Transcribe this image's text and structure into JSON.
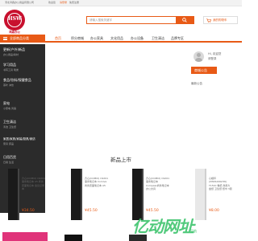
{
  "topbar": {
    "company": "河北鸿森办公用品有限公司",
    "welcome": "欢迎您",
    "signin": "请登录",
    "register": "免费注册"
  },
  "logo": {
    "mark": "HSW",
    "name": "鸿森办公"
  },
  "search": {
    "placeholder": "请输入搜索关键字"
  },
  "cart": {
    "label": "我的购物车"
  },
  "nav": {
    "all_categories": "全部商品分类",
    "items": [
      "首页",
      "积分商城",
      "办公家具",
      "文化用品",
      "办公设备",
      "卫生清洁",
      "品牌专区"
    ]
  },
  "sidebar": {
    "categories": [
      {
        "title": "更新(户外)新品",
        "sub": "办公用品/耗材"
      },
      {
        "title": "学习用品",
        "sub": "书写工具 笔类"
      },
      {
        "title": "食品/饮料/保健食品",
        "sub": "茶叶 冲饮"
      },
      {
        "title": "家电",
        "sub": "小家电 风扇"
      },
      {
        "title": "卫生清洁",
        "sub": "清洁 卫生纸"
      },
      {
        "title": "家居/家具/家装/厨具/家纺",
        "sub": "家具 床品"
      },
      {
        "title": "日用百货",
        "sub": "日用 生活"
      }
    ]
  },
  "user_panel": {
    "greeting": "Hi, 欢迎您",
    "signin": "请登录",
    "notice_button": "商城公告",
    "announcement": "最新公告"
  },
  "section": {
    "title": "新品上市"
  },
  "products": [
    {
      "desc": "齐心(COMIX) C9201 事务笔记本 A5 商务皮面笔记本 会议记录本",
      "price": "¥34.50"
    },
    {
      "desc": "齐心(COMIX) C9201 事务笔记本 Comiva商务皮面笔记本 A5",
      "price": "¥45.50"
    },
    {
      "desc": "齐心(COMIX) C9201 事务笔记本 Compass商务笔记本 办公文具",
      "price": "¥45.50"
    },
    {
      "desc": "心相印(XINXIANGYIN) T1510 卷纸 商用大盘纸 卫生纸 纸巾 3层",
      "price": "¥8.00"
    }
  ],
  "watermark": {
    "logo_text": "亿动网址",
    "sub_text": "导航"
  },
  "colors": {
    "accent": "#e85a16",
    "sidebar_bg": "#2b2b2b",
    "logo_red": "#c8102e",
    "watermark_green": "#3ec46d"
  }
}
